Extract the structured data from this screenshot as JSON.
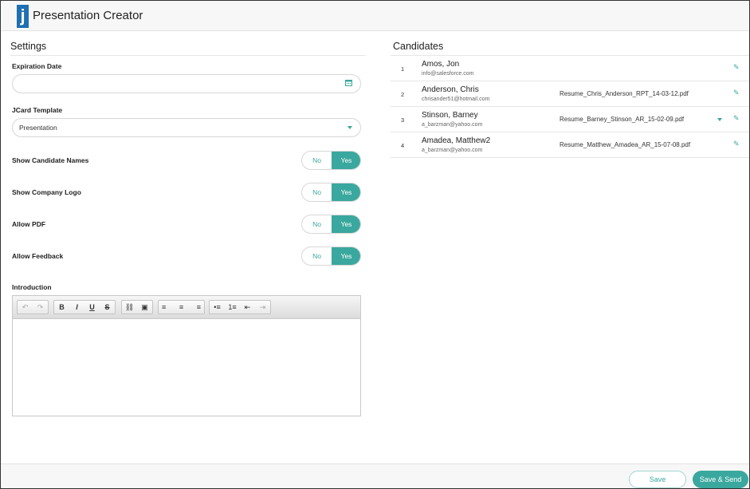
{
  "app": {
    "logo_letter": "j",
    "title": "Presentation Creator"
  },
  "settings": {
    "title": "Settings",
    "expiration": {
      "label": "Expiration Date",
      "value": "",
      "icon": "calendar-icon"
    },
    "template": {
      "label": "JCard Template",
      "value": "Presentation"
    },
    "toggles": [
      {
        "label": "Show Candidate Names",
        "no": "No",
        "yes": "Yes",
        "selected": "Yes"
      },
      {
        "label": "Show Company Logo",
        "no": "No",
        "yes": "Yes",
        "selected": "Yes"
      },
      {
        "label": "Allow PDF",
        "no": "No",
        "yes": "Yes",
        "selected": "Yes"
      },
      {
        "label": "Allow Feedback",
        "no": "No",
        "yes": "Yes",
        "selected": "Yes"
      }
    ],
    "introduction": {
      "label": "Introduction",
      "toolbar": {
        "undo": "↶",
        "redo": "↷",
        "bold": "B",
        "italic": "I",
        "underline": "U",
        "strike": "S",
        "link": "⛓",
        "image": "▣",
        "align_left": "≡",
        "align_center": "≡",
        "align_right": "≡",
        "bullets": "•≡",
        "numbers": "1≡",
        "outdent": "⇤",
        "indent": "⇥"
      }
    }
  },
  "candidates": {
    "title": "Candidates",
    "rows": [
      {
        "index": "1",
        "name": "Amos, Jon",
        "email": "info@salesforce.com",
        "file": ""
      },
      {
        "index": "2",
        "name": "Anderson, Chris",
        "email": "chrisander51@hotmail.com",
        "file": "Resume_Chris_Anderson_RPT_14-03-12.pdf"
      },
      {
        "index": "3",
        "name": "Stinson, Barney",
        "email": "a_barzman@yahoo.com",
        "file": "Resume_Barney_Stinson_AR_15-02-09.pdf"
      },
      {
        "index": "4",
        "name": "Amadea, Matthew2",
        "email": "a_barzman@yahoo.com",
        "file": "Resume_Matthew_Amadea_AR_15-07-08.pdf"
      }
    ]
  },
  "footer": {
    "save": "Save",
    "save_send": "Save & Send"
  },
  "colors": {
    "accent": "#3aa89e",
    "brand": "#1f6fb2"
  }
}
